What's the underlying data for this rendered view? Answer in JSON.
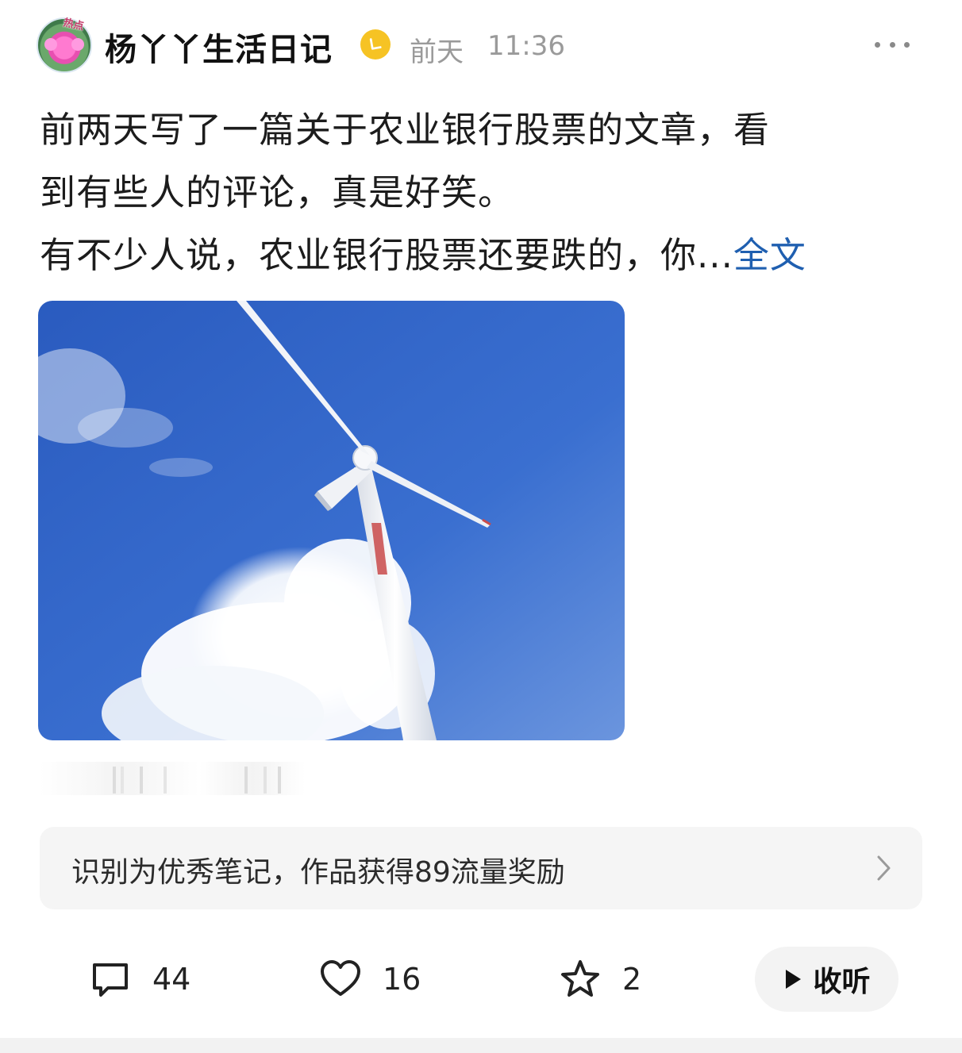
{
  "author": {
    "name": "杨丫丫生活日记",
    "avatar_badge": "热点",
    "verified_icon": "verified-badge-icon"
  },
  "meta": {
    "day": "前天",
    "time": "11:36",
    "more_icon": "more-dots-icon"
  },
  "post": {
    "line1": " 前两天写了一篇关于农业银行股票的文章，看",
    "line2": "到有些人的评论，真是好笑。",
    "line3": "有不少人说，农业银行股票还要跌的，你...",
    "full_link": "全文",
    "image_alt": "wind-turbine-photo"
  },
  "reward": {
    "text": "识别为优秀笔记，作品获得89流量奖励",
    "chevron_icon": "chevron-right-icon"
  },
  "actions": {
    "comments": {
      "icon": "comment-icon",
      "count": "44"
    },
    "likes": {
      "icon": "heart-icon",
      "count": "16"
    },
    "favorites": {
      "icon": "star-icon",
      "count": "2"
    },
    "listen": {
      "icon": "play-icon",
      "label": "收听"
    }
  },
  "colors": {
    "link": "#1f5fb0",
    "verified": "#f6c324",
    "sky_top": "#2f63c5",
    "sky_bottom": "#5f8fdc"
  }
}
